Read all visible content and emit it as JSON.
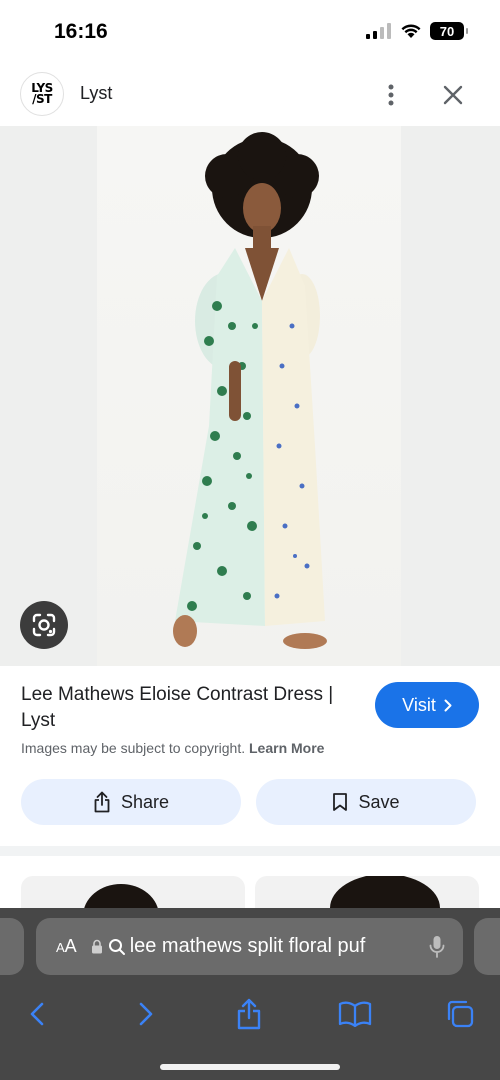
{
  "status_bar": {
    "time": "16:16",
    "battery": "70"
  },
  "source": {
    "logo_line1": "LYS",
    "logo_line2": "/ST",
    "name": "Lyst"
  },
  "result": {
    "title": "Lee Mathews Eloise Contrast Dress | Lyst",
    "visit_label": "Visit",
    "copyright_text": "Images may be subject to copyright.",
    "learn_more": "Learn More",
    "share_label": "Share",
    "save_label": "Save"
  },
  "browser": {
    "aa_label": "A",
    "aa_large": "A",
    "address_text": "lee mathews split floral puf"
  },
  "colors": {
    "accent": "#1a73e8",
    "action_bg": "#e8f0fe",
    "toolbar_bg": "#474747",
    "toolbar_icon": "#3b82f6"
  },
  "icons": {
    "signal": "cellular-signal-icon",
    "wifi": "wifi-icon",
    "more": "more-vert-icon",
    "close": "close-icon",
    "lens": "google-lens-icon",
    "share": "share-icon",
    "save": "bookmark-icon",
    "lock": "lock-icon",
    "search": "search-icon",
    "mic": "microphone-icon",
    "back": "back-chevron-icon",
    "forward": "forward-chevron-icon",
    "safari_share": "safari-share-icon",
    "bookmarks": "book-icon",
    "tabs": "tabs-icon"
  }
}
